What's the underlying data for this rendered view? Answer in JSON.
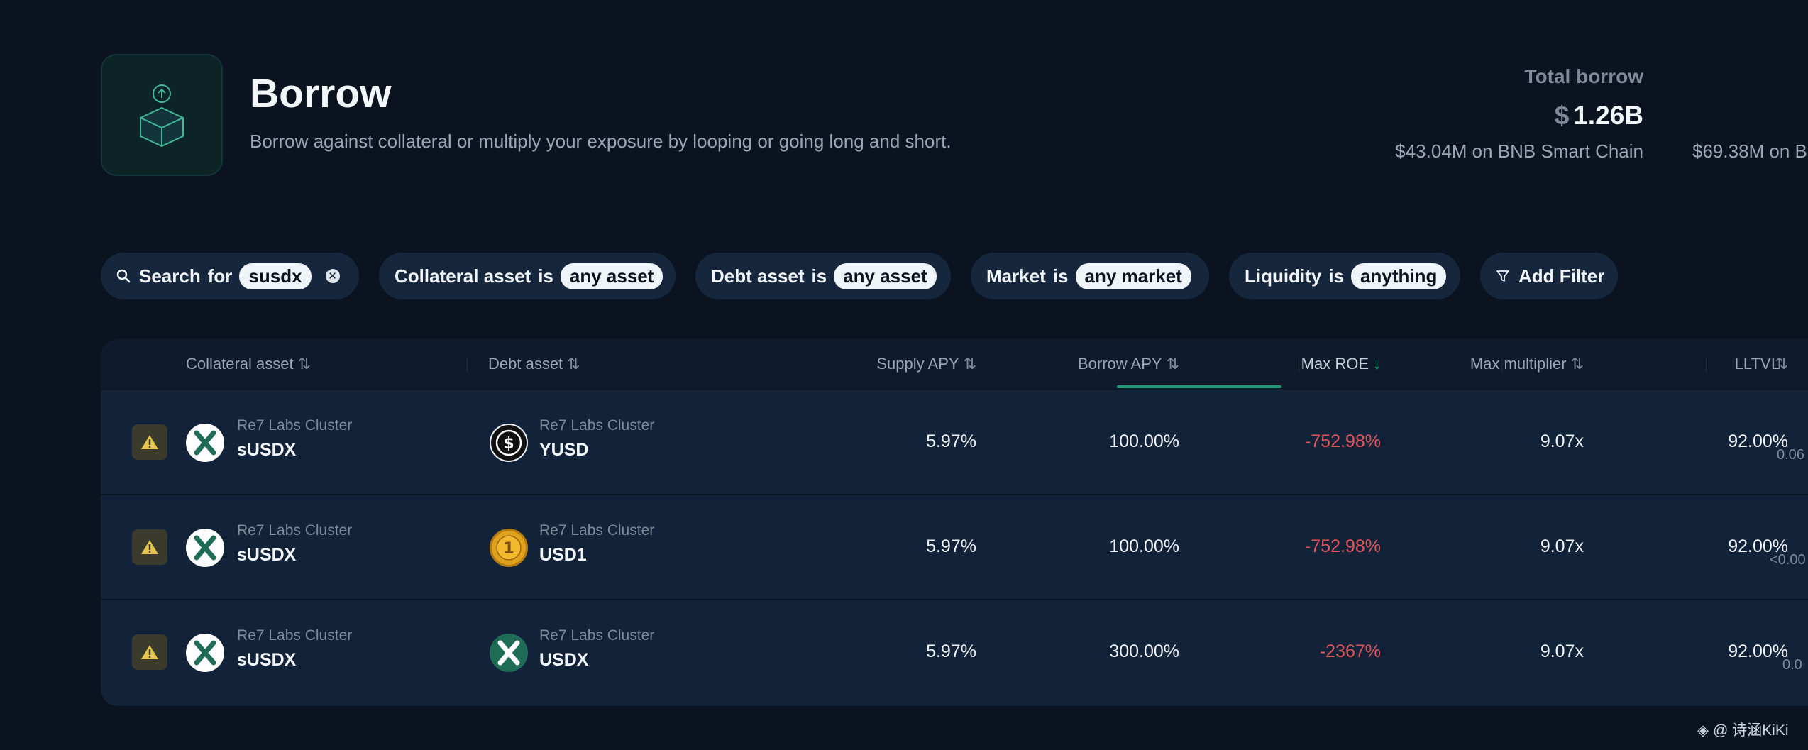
{
  "header": {
    "title": "Borrow",
    "subtitle": "Borrow against collateral or multiply your exposure by looping or going long and short.",
    "total_label": "Total borrow",
    "total_currency": "$",
    "total_value": "1.26B",
    "chain_breakdown": [
      "$43.04M on BNB Smart Chain",
      "$69.38M on B"
    ]
  },
  "filters": {
    "search": {
      "prefix": "Search",
      "keyword": "for",
      "value": "susdx"
    },
    "collateral": {
      "field": "Collateral asset",
      "op": "is",
      "value": "any asset"
    },
    "debt": {
      "field": "Debt asset",
      "op": "is",
      "value": "any asset"
    },
    "market": {
      "field": "Market",
      "op": "is",
      "value": "any market"
    },
    "liquidity": {
      "field": "Liquidity",
      "op": "is",
      "value": "anything"
    },
    "add_filter_label": "Add Filter"
  },
  "table": {
    "columns": [
      "Collateral asset",
      "Debt asset",
      "Supply APY",
      "Borrow APY",
      "Max ROE",
      "Max multiplier",
      "LLTV",
      "L"
    ],
    "active_sort_column": "Max ROE",
    "rows": [
      {
        "collateral_sub": "Re7 Labs Cluster",
        "collateral": "sUSDX",
        "debt_sub": "Re7 Labs Cluster",
        "debt": "YUSD",
        "supply_apy": "5.97%",
        "borrow_apy": "100.00%",
        "max_roe": "-752.98%",
        "max_multiplier": "9.07x",
        "lltv": "92.00%",
        "liquidity": "0.06"
      },
      {
        "collateral_sub": "Re7 Labs Cluster",
        "collateral": "sUSDX",
        "debt_sub": "Re7 Labs Cluster",
        "debt": "USD1",
        "supply_apy": "5.97%",
        "borrow_apy": "100.00%",
        "max_roe": "-752.98%",
        "max_multiplier": "9.07x",
        "lltv": "92.00%",
        "liquidity": "<0.00"
      },
      {
        "collateral_sub": "Re7 Labs Cluster",
        "collateral": "sUSDX",
        "debt_sub": "Re7 Labs Cluster",
        "debt": "USDX",
        "supply_apy": "5.97%",
        "borrow_apy": "300.00%",
        "max_roe": "-2367%",
        "max_multiplier": "9.07x",
        "lltv": "92.00%",
        "liquidity": "0.0"
      }
    ]
  },
  "watermark": "@ 诗涵KiKi",
  "colors": {
    "background": "#0b1320",
    "accent": "#1f9a76",
    "negative": "#e0555a",
    "warning": "#e6c34a"
  }
}
